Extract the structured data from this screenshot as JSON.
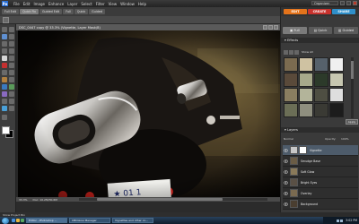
{
  "app": {
    "logo": "Pe",
    "menus": [
      "File",
      "Edit",
      "Image",
      "Enhance",
      "Layer",
      "Select",
      "Filter",
      "View",
      "Window",
      "Help"
    ],
    "organizer": "Organizer"
  },
  "modes": [
    "Full Edit",
    "Quick Fix",
    "Guided Edit",
    "Full",
    "Quick",
    "Guided"
  ],
  "panel_tabs": {
    "edit": "EDIT",
    "create": "CREATE",
    "share": "SHARE"
  },
  "view_tabs": [
    {
      "label": "Full",
      "active": true
    },
    {
      "label": "Quick",
      "active": false
    },
    {
      "label": "Guided",
      "active": false
    }
  ],
  "document": {
    "title": "DSC_0447 copy @ 33.3% (Vignette, Layer Mask/8)",
    "zoom": "33.3%",
    "info": "Doc: 10.2M/30.6M"
  },
  "effects": {
    "header": "Effects",
    "show_all": "Show All",
    "apply_label": "Apply",
    "thumbs": [
      "#7b6b50",
      "#cfc2a2",
      "#56616b",
      "#f0f0f0",
      "#5a4a3a",
      "#a7a98b",
      "#2c3a2a",
      "#c6c6b0",
      "#8a7e60",
      "#b3b49a",
      "#4e4e42",
      "#dedede",
      "#6b6e56",
      "#8f8f7f",
      "#3a3a34",
      "#1c1c1c"
    ]
  },
  "layers": {
    "header": "Layers",
    "mode": "Normal",
    "opacity_label": "Opacity:",
    "opacity": "100%",
    "items": [
      {
        "name": "Vignette",
        "selected": true,
        "mask": true
      },
      {
        "name": "Smudge Base",
        "selected": false,
        "mask": false
      },
      {
        "name": "Soft Glow",
        "selected": false,
        "mask": false
      },
      {
        "name": "Bright Eyes",
        "selected": false,
        "mask": false
      },
      {
        "name": "Overlay",
        "selected": false,
        "mask": false
      },
      {
        "name": "Background",
        "selected": false,
        "mask": false
      }
    ]
  },
  "project_bin": "Show Project Bin",
  "taskbar": {
    "buttons": [
      "Editor - Photoshop ...",
      "CBCGlow Manager",
      "Vignettes and other co..."
    ],
    "clock": "3:02 PM"
  }
}
